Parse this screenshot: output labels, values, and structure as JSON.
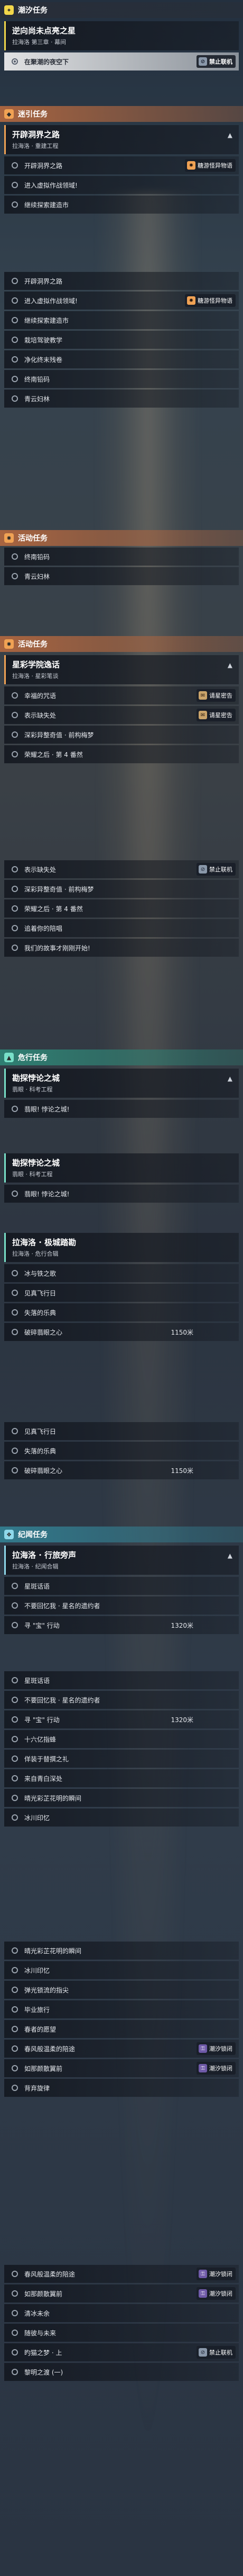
{
  "sections": {
    "s1": {
      "header": "潮汐任务",
      "card": {
        "title": "逆向尚未点亮之星",
        "sub": "拉海洛 第三章 · 幕间"
      },
      "steps": [
        {
          "label": "在聚潮的夜空下",
          "badge": "禁止联机"
        }
      ]
    },
    "s2": {
      "header": "迷引任务",
      "card": {
        "title": "开辟洞界之路",
        "sub": "拉海洛 · 重建工程"
      },
      "steps": [
        {
          "label": "开辟洞界之路",
          "badge": "糖游怪异物语"
        },
        {
          "label": "进入虚拟作战领域!"
        },
        {
          "label": "继续探索建造市"
        }
      ]
    },
    "s3": {
      "steps": [
        {
          "label": "开辟洞界之路"
        },
        {
          "label": "进入虚拟作战领域!",
          "badge": "糖游怪异物语"
        },
        {
          "label": "继续探索建造市"
        },
        {
          "label": "栽培驾驶教学"
        },
        {
          "label": "净化终末残卷"
        },
        {
          "label": "终南铅码"
        },
        {
          "label": "青云妇林"
        }
      ]
    },
    "s4": {
      "header": "活动任务",
      "steps": [
        {
          "label": "终南铅码"
        },
        {
          "label": "青云妇林"
        }
      ]
    },
    "s5": {
      "header": "活动任务",
      "card": {
        "title": "星彩学院逸话",
        "sub": "拉海洛 · 星彩笔谈"
      },
      "steps": [
        {
          "label": "幸福的咒语",
          "badge": "请星密告"
        },
        {
          "label": "表示缺失处",
          "badge": "请星密告"
        },
        {
          "label": "深彩异整奇值 · 前构梅梦"
        },
        {
          "label": "荣耀之后 · 第 4 番然"
        }
      ]
    },
    "s6": {
      "steps": [
        {
          "label": "表示缺失处",
          "badge": "禁止联机"
        },
        {
          "label": "深彩异整奇值 · 前构梅梦"
        },
        {
          "label": "荣耀之后 · 第 4 番然"
        },
        {
          "label": "追着你的陪唱"
        },
        {
          "label": "我们的故事才刚刚开始!"
        }
      ]
    },
    "s7": {
      "header": "危行任务",
      "card": {
        "title": "勘探悖论之城",
        "sub": "翡眼 · 科考工程"
      },
      "steps": [
        {
          "label": "翡眼! 悖论之城!"
        }
      ]
    },
    "s8": {
      "card": {
        "title": "勘探悖论之城",
        "sub": "翡眼 · 科考工程"
      },
      "steps": [
        {
          "label": "翡眼! 悖论之城!"
        }
      ]
    },
    "s9": {
      "card": {
        "title": "拉海洛 · 极城踏勘",
        "sub": "拉海洛 · 危行合辑"
      },
      "steps": [
        {
          "label": "冰与铁之歌"
        },
        {
          "label": "见真飞行日"
        },
        {
          "label": "失落的乐典"
        },
        {
          "label": "破碎翡眼之心",
          "dist": "1150米"
        }
      ]
    },
    "s10": {
      "steps": [
        {
          "label": "见真飞行日"
        },
        {
          "label": "失落的乐典"
        },
        {
          "label": "破碎翡眼之心",
          "dist": "1150米"
        }
      ]
    },
    "s11": {
      "header": "纪闻任务",
      "card": {
        "title": "拉海洛 · 行旅旁声",
        "sub": "拉海洛 · 纪闻合辑"
      },
      "steps": [
        {
          "label": "星斑话语"
        },
        {
          "label": "不要回忆我 · 星名的遗约者"
        },
        {
          "label": "寻 \"宝\" 行动",
          "dist": "1320米"
        }
      ]
    },
    "s12": {
      "steps": [
        {
          "label": "星斑话语"
        },
        {
          "label": "不要回忆我 · 星名的遗约者"
        },
        {
          "label": "寻 \"宝\" 行动",
          "dist": "1320米"
        },
        {
          "label": "十六亿指蜂"
        },
        {
          "label": "佯装于替撰之礼"
        },
        {
          "label": "来自青白深处"
        },
        {
          "label": "晴光彩芷花明的瞬间"
        },
        {
          "label": "冰川印忆"
        }
      ]
    },
    "s13": {
      "steps": [
        {
          "label": "晴光彩芷花明的瞬间"
        },
        {
          "label": "冰川印忆"
        },
        {
          "label": "弹光锁流的指尖"
        },
        {
          "label": "毕业旅行"
        },
        {
          "label": "春者的愿望"
        },
        {
          "label": "春风般温柔的陪途",
          "badge": "潮汐锁闭"
        },
        {
          "label": "如那颜散翼前",
          "badge": "潮汐锁闭"
        },
        {
          "label": "背弃旋律"
        }
      ]
    },
    "s14": {
      "steps": [
        {
          "label": "春风般温柔的陪途",
          "badge": "潮汐锁闭"
        },
        {
          "label": "如那颜散翼前",
          "badge": "潮汐锁闭"
        },
        {
          "label": "清冰未余"
        },
        {
          "label": "随彼与未来"
        },
        {
          "label": "旳猫之梦 · 上",
          "badge": "禁止联机"
        },
        {
          "label": "黎明之渡 (一)"
        }
      ]
    }
  }
}
